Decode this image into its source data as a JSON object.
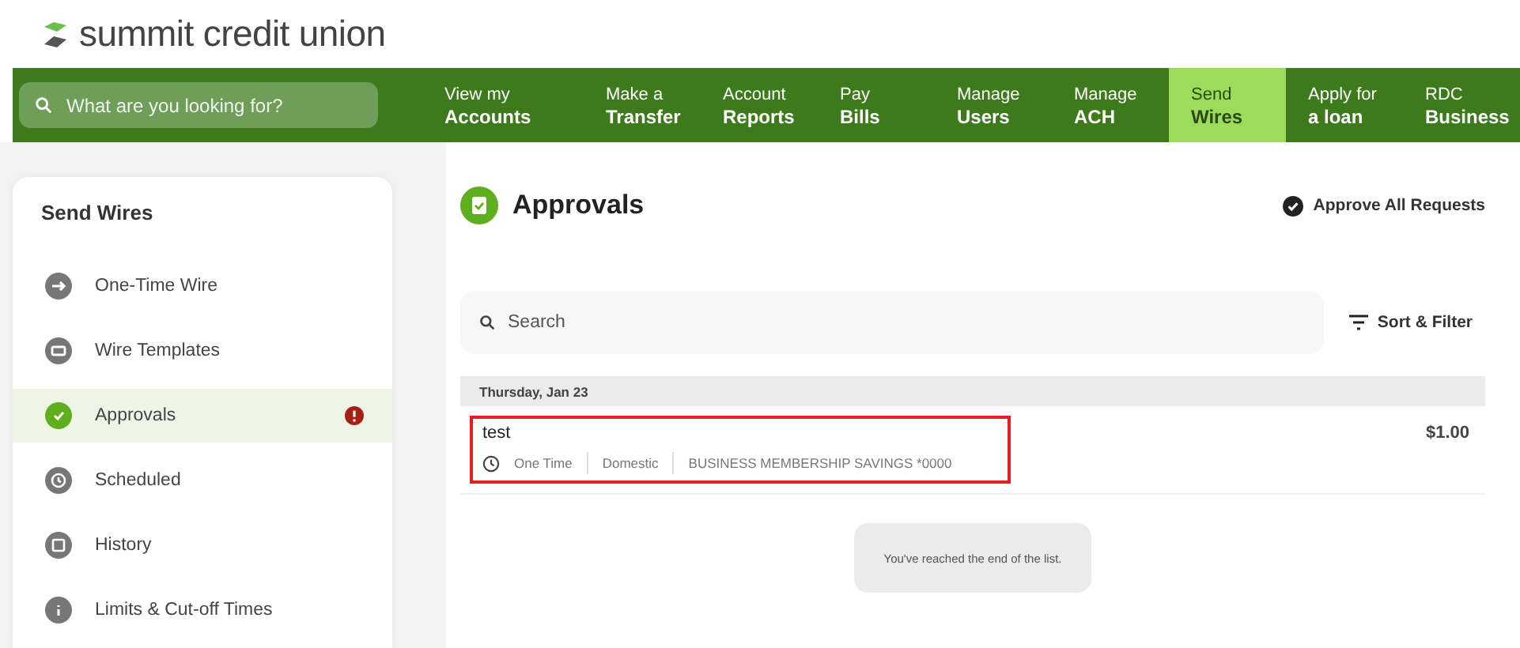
{
  "brand": {
    "name": "summit credit union"
  },
  "nav": {
    "search": {
      "placeholder": "What are you looking for?"
    },
    "items": [
      {
        "top": "View my",
        "bottom": "Accounts",
        "selected": false
      },
      {
        "top": "Make a",
        "bottom": "Transfer",
        "selected": false
      },
      {
        "top": "Account",
        "bottom": "Reports",
        "selected": false
      },
      {
        "top": "Pay",
        "bottom": "Bills",
        "selected": false
      },
      {
        "top": "Manage",
        "bottom": "Users",
        "selected": false
      },
      {
        "top": "Manage",
        "bottom": "ACH",
        "selected": false
      },
      {
        "top": "Send",
        "bottom": "Wires",
        "selected": true
      },
      {
        "top": "Apply for",
        "bottom": "a loan",
        "selected": false
      },
      {
        "top": "RDC",
        "bottom": "Business",
        "selected": false
      }
    ]
  },
  "sidebar": {
    "title": "Send Wires",
    "items": [
      {
        "label": "One-Time Wire",
        "selected": false,
        "alert": false
      },
      {
        "label": "Wire Templates",
        "selected": false,
        "alert": false
      },
      {
        "label": "Approvals",
        "selected": true,
        "alert": true
      },
      {
        "label": "Scheduled",
        "selected": false,
        "alert": false
      },
      {
        "label": "History",
        "selected": false,
        "alert": false
      },
      {
        "label": "Limits & Cut-off Times",
        "selected": false,
        "alert": false
      }
    ]
  },
  "main": {
    "title": "Approvals",
    "approve_all": "Approve All Requests",
    "search": {
      "placeholder": "Search"
    },
    "sort_filter": "Sort & Filter",
    "groups": [
      {
        "date": "Thursday, Jan 23",
        "items": [
          {
            "name": "test",
            "amount": "$1.00",
            "highlighted": true,
            "meta": [
              "One Time",
              "Domestic",
              "BUSINESS MEMBERSHIP SAVINGS *0000"
            ]
          }
        ]
      }
    ],
    "end_message": "You've reached the end of the list."
  }
}
